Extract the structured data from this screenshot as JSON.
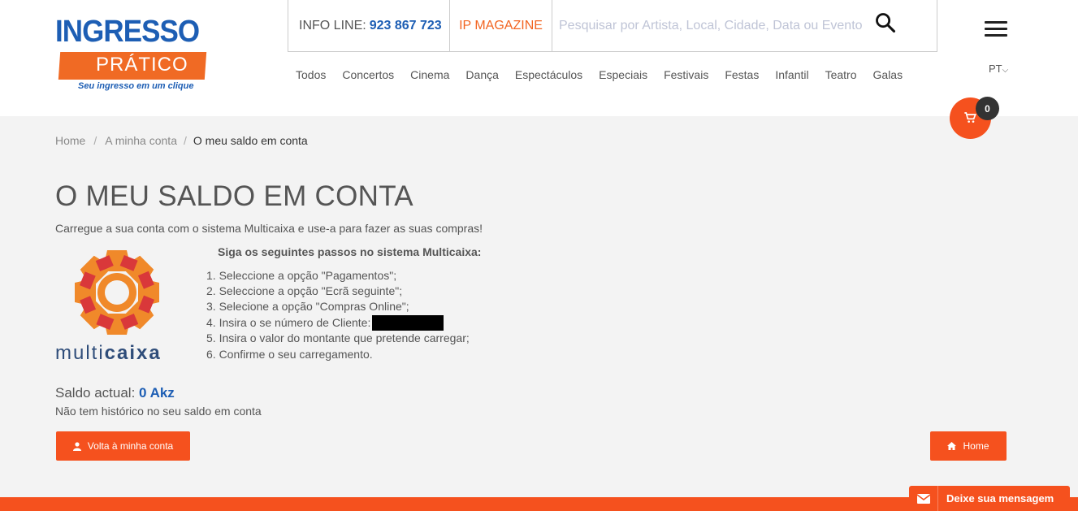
{
  "brand": {
    "logo_top": "INGRESSO",
    "logo_mid": "PRÁTICO",
    "logo_sub": "Seu ingresso em um clique"
  },
  "topbar": {
    "info_label": "INFO LINE:",
    "info_phone": "923 867 723",
    "magazine": "IP MAGAZINE",
    "search_placeholder": "Pesquisar por Artista, Local, Cidade, Data ou Evento"
  },
  "nav": [
    "Todos",
    "Concertos",
    "Cinema",
    "Dança",
    "Espectáculos",
    "Especiais",
    "Festivais",
    "Festas",
    "Infantil",
    "Teatro",
    "Galas"
  ],
  "lang": "PT",
  "cart": {
    "count": "0"
  },
  "breadcrumb": {
    "home": "Home",
    "account": "A minha conta",
    "current": "O meu saldo em conta"
  },
  "main": {
    "title": "O MEU SALDO EM CONTA",
    "intro": "Carregue a sua conta com o sistema Multicaixa e use-a para fazer as suas compras!",
    "steps_title": "Siga os seguintes passos no sistema Multicaixa:",
    "steps": [
      "1. Seleccione a opção \"Pagamentos\";",
      "2. Seleccione a opção \"Ecrã seguinte\";",
      "3. Selecione a opção \"Compras Online\";",
      "4. Insira o se número de Cliente:",
      "5. Insira o valor do montante que pretende carregar;",
      "6. Confirme o seu carregamento."
    ],
    "logo_text_light": "multi",
    "logo_text_bold": "caixa",
    "saldo_label": "Saldo actual:",
    "saldo_value": "0 Akz",
    "no_history": "Não tem histórico no seu saldo em conta",
    "btn_account": "Volta à minha conta",
    "btn_home": "Home"
  },
  "message_button": "Deixe sua mensagem",
  "colors": {
    "brand_blue": "#1d5eb4",
    "brand_orange": "#f5511e"
  }
}
